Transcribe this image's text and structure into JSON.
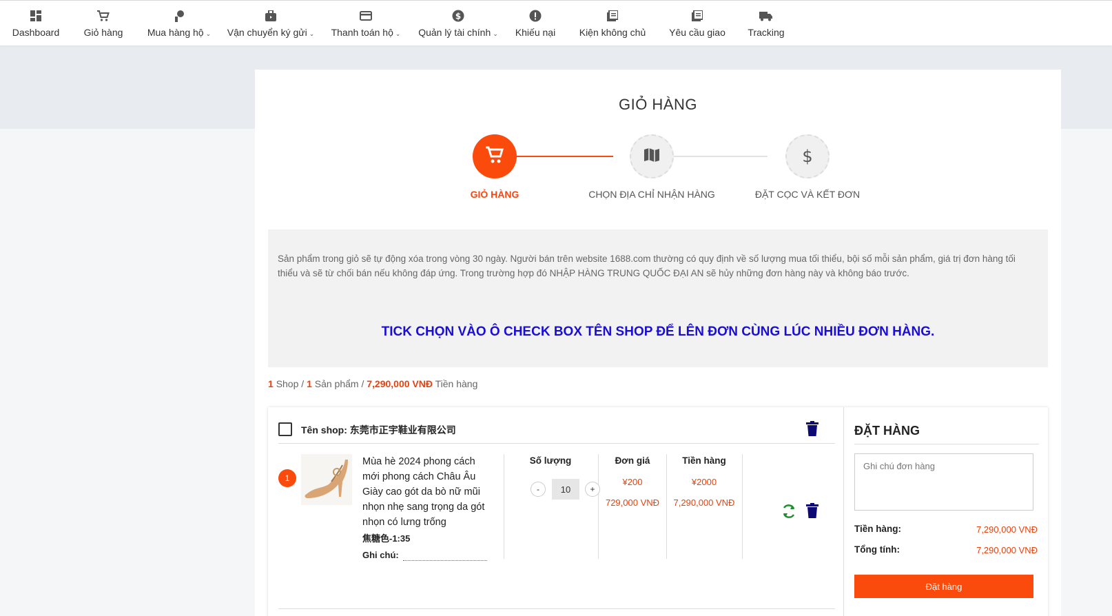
{
  "nav": {
    "items": [
      {
        "label": "Dashboard",
        "icon": "dashboard-icon"
      },
      {
        "label": "Giỏ hàng",
        "icon": "cart-icon"
      },
      {
        "label": "Mua hàng hộ",
        "icon": "buy-icon",
        "dropdown": true
      },
      {
        "label": "Vận chuyển ký gửi",
        "icon": "shipping-bag-icon",
        "dropdown": true
      },
      {
        "label": "Thanh toán hộ",
        "icon": "card-icon",
        "dropdown": true
      },
      {
        "label": "Quản lý tài chính",
        "icon": "dollar-icon",
        "dropdown": true
      },
      {
        "label": "Khiếu nại",
        "icon": "alert-icon"
      },
      {
        "label": "Kiện không chủ",
        "icon": "list-icon"
      },
      {
        "label": "Yêu cầu giao",
        "icon": "list-icon"
      },
      {
        "label": "Tracking",
        "icon": "truck-icon"
      }
    ]
  },
  "page": {
    "title": "GIỎ HÀNG"
  },
  "stepper": {
    "steps": [
      {
        "label": "GIỎ HÀNG",
        "icon": "cart-icon",
        "active": true
      },
      {
        "label": "CHỌN ĐỊA CHỈ NHẬN HÀNG",
        "icon": "map-icon",
        "active": false
      },
      {
        "label": "ĐẶT CỌC VÀ KẾT ĐƠN",
        "icon": "dollar-icon",
        "active": false
      }
    ]
  },
  "notice": {
    "text": "Sản phẩm trong giỏ sẽ tự động xóa trong vòng 30 ngày. Người bán trên website 1688.com thường có quy định về số lượng mua tối thiểu, bội số mỗi sản phẩm, giá trị đơn hàng tối thiểu và sẽ từ chối bán nếu không đáp ứng. Trong trường hợp đó NHẬP HÀNG TRUNG QUỐC ĐẠI AN sẽ hủy những đơn hàng này và không báo trước.",
    "tick_message": "TICK CHỌN VÀO Ô CHECK BOX TÊN SHOP ĐỂ LÊN ĐƠN CÙNG LÚC NHIỀU ĐƠN HÀNG."
  },
  "summary": {
    "shop_count": "1",
    "shop_label": "Shop /",
    "product_count": "1",
    "product_label": "Sản phẩm /",
    "total": "7,290,000 VNĐ",
    "total_label": "Tiền hàng"
  },
  "shop": {
    "label": "Tên shop:",
    "name": "东莞市正宇鞋业有限公司",
    "item": {
      "index": "1",
      "name": "Mùa hè 2024 phong cách mới phong cách Châu Âu Giày cao gót da bò nữ mũi nhọn nhẹ sang trọng da gót nhọn có lưng trống",
      "variant": "焦糖色-1:35",
      "note_label": "Ghi chú:",
      "quantity": "10",
      "unit_price_cny": "¥200",
      "unit_price_vnd": "729,000 VNĐ",
      "total_cny": "¥2000",
      "total_vnd": "7,290,000 VNĐ"
    },
    "columns": {
      "quantity": "Số lượng",
      "unit_price": "Đơn giá",
      "total": "Tiền hàng"
    },
    "qty_minus": "-",
    "qty_plus": "+"
  },
  "order_panel": {
    "title": "ĐẶT HÀNG",
    "note_placeholder": "Ghi chú đơn hàng",
    "subtotal_label": "Tiền hàng:",
    "subtotal_value": "7,290,000 VNĐ",
    "total_label": "Tổng tính:",
    "total_value": "7,290,000 VNĐ",
    "button": "Đặt hàng"
  },
  "colors": {
    "accent": "#fa4a0c",
    "tick_blue": "#1a0ed6",
    "trash": "#0d0a73",
    "refresh": "#1f8e2e"
  }
}
